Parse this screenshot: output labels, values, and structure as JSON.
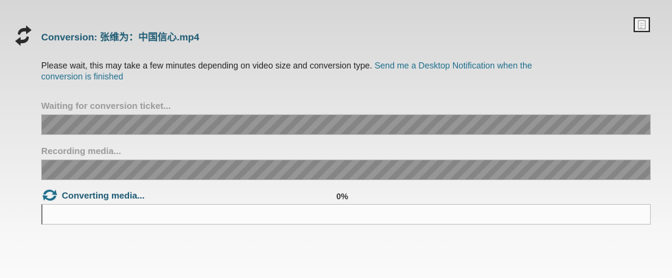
{
  "dialog": {
    "title_prefix": "Conversion:",
    "filename": "张维为：中国信心.mp4",
    "close_icon": "document-close-icon"
  },
  "info": {
    "message": "Please wait, this may take a few minutes depending on video size and conversion type.",
    "notification_link": "Send me a Desktop Notification when the conversion is finished"
  },
  "steps": [
    {
      "label": "Waiting for conversion ticket...",
      "status": "complete",
      "icon": "none"
    },
    {
      "label": "Recording media...",
      "status": "complete",
      "icon": "none"
    },
    {
      "label": "Converting media...",
      "status": "active",
      "icon": "refresh-icon",
      "progress_label": "0%",
      "progress": 0
    }
  ],
  "colors": {
    "title": "#1c5a73",
    "link": "#1f6e8c",
    "done_bar": "#8a8a8a",
    "pending_label": "#9a9a9a"
  }
}
